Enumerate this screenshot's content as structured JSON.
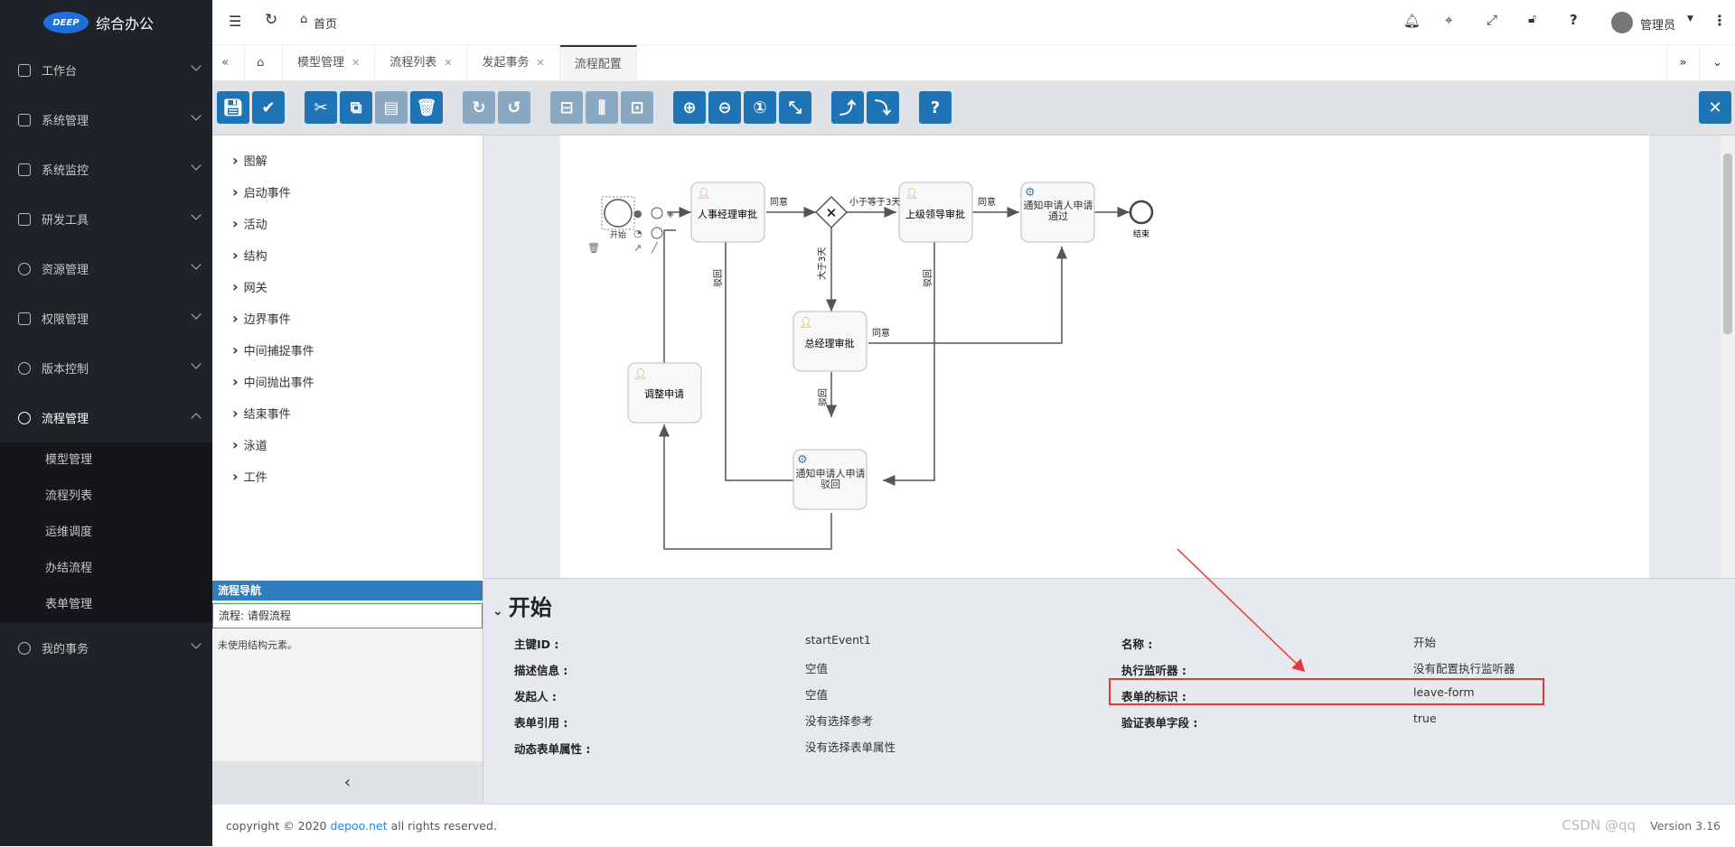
{
  "app": {
    "logo_badge": "DEEP",
    "title": "综合办公"
  },
  "sidebar": {
    "items": [
      {
        "label": "工作台"
      },
      {
        "label": "系统管理"
      },
      {
        "label": "系统监控"
      },
      {
        "label": "研发工具"
      },
      {
        "label": "资源管理"
      },
      {
        "label": "权限管理"
      },
      {
        "label": "版本控制"
      },
      {
        "label": "流程管理"
      }
    ],
    "sub": [
      "模型管理",
      "流程列表",
      "运维调度",
      "办结流程",
      "表单管理"
    ],
    "last": "我的事务"
  },
  "topbar": {
    "home": "首页",
    "user": "管理员"
  },
  "tabs": [
    "模型管理",
    "流程列表",
    "发起事务",
    "流程配置"
  ],
  "palette": [
    "图解",
    "启动事件",
    "活动",
    "结构",
    "网关",
    "边界事件",
    "中间捕捉事件",
    "中间抛出事件",
    "结束事件",
    "泳道",
    "工件"
  ],
  "nav": {
    "header": "流程导航",
    "selected": "流程: 请假流程",
    "info": "未使用结构元素。"
  },
  "diagram": {
    "start": "开始",
    "end": "结束",
    "hr": "人事经理审批",
    "leader": "上级领导审批",
    "notify_ok": "通知申请人申请通过",
    "gm": "总经理审批",
    "adjust": "调整申请",
    "notify_rej": "通知申请人申请驳回",
    "agree": "同意",
    "reject": "驳回",
    "le3": "小于等于3天",
    "gt3": "大于3天"
  },
  "props": {
    "title": "开始",
    "left": [
      {
        "label": "主键ID :",
        "value": "startEvent1"
      },
      {
        "label": "描述信息 :",
        "value": "空值"
      },
      {
        "label": "发起人 :",
        "value": "空值"
      },
      {
        "label": "表单引用 :",
        "value": "没有选择参考"
      },
      {
        "label": "动态表单属性 :",
        "value": "没有选择表单属性"
      }
    ],
    "right": [
      {
        "label": "名称 :",
        "value": "开始"
      },
      {
        "label": "执行监听器 :",
        "value": "没有配置执行监听器"
      },
      {
        "label": "表单的标识 :",
        "value": "leave-form"
      },
      {
        "label": "验证表单字段 :",
        "value": "true"
      }
    ]
  },
  "footer": {
    "pre": "copyright © 2020 ",
    "link": "depoo.net",
    "post": " all rights reserved.",
    "version": "Version 3.16"
  },
  "watermark": "CSDN @qq"
}
